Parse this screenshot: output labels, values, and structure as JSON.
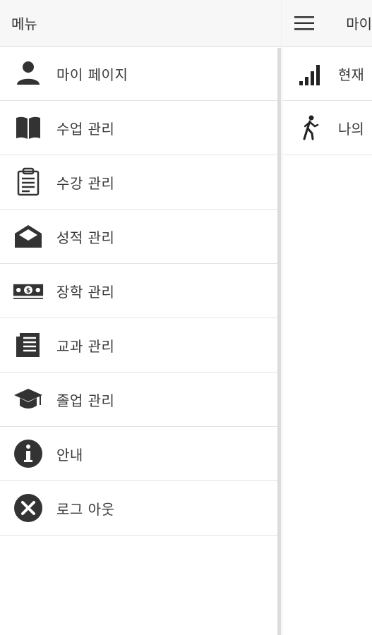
{
  "drawer": {
    "title": "메뉴",
    "items": [
      {
        "label": "마이 페이지",
        "icon": "person-icon"
      },
      {
        "label": "수업 관리",
        "icon": "book-icon"
      },
      {
        "label": "수강 관리",
        "icon": "clipboard-icon"
      },
      {
        "label": "성적 관리",
        "icon": "envelope-icon"
      },
      {
        "label": "장학 관리",
        "icon": "money-icon"
      },
      {
        "label": "교과 관리",
        "icon": "newspaper-icon"
      },
      {
        "label": "졸업 관리",
        "icon": "graduation-cap-icon"
      },
      {
        "label": "안내",
        "icon": "info-icon"
      },
      {
        "label": "로그 아웃",
        "icon": "logout-icon"
      }
    ]
  },
  "main": {
    "title": "마이",
    "items": [
      {
        "label": "현재",
        "icon": "signal-bars-icon"
      },
      {
        "label": "나의",
        "icon": "walking-person-icon"
      }
    ]
  },
  "colors": {
    "icon": "#333333",
    "header_bg": "#f7f7f7",
    "divider": "#e3e3e3"
  }
}
